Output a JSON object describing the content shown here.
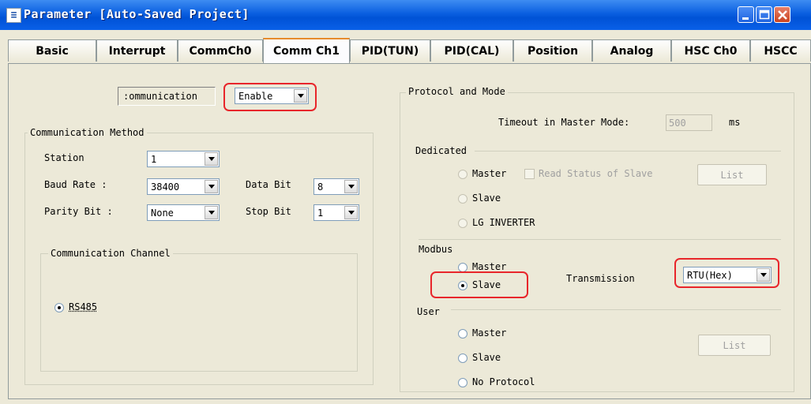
{
  "window": {
    "title": "Parameter [Auto-Saved Project]",
    "title_icon": "hanzi-icon"
  },
  "tabs": [
    "Basic",
    "Interrupt",
    "CommCh0",
    "Comm Ch1",
    "PID(TUN)",
    "PID(CAL)",
    "Position",
    "Analog",
    "HSC Ch0",
    "HSCC"
  ],
  "active_tab": "Comm Ch1",
  "communication": {
    "label": ":ommunication",
    "value": "Enable"
  },
  "method": {
    "title": "Communication Method",
    "station_label": "Station",
    "station_value": "1",
    "baud_label": "Baud Rate :",
    "baud_value": "38400",
    "databit_label": "Data Bit",
    "databit_value": "8",
    "parity_label": "Parity Bit :",
    "parity_value": "None",
    "stopbit_label": "Stop Bit",
    "stopbit_value": "1"
  },
  "channel": {
    "title": "Communication Channel",
    "option": "RS485"
  },
  "protocol": {
    "title": "Protocol and Mode",
    "timeout_label": "Timeout in Master Mode:",
    "timeout_value": "500",
    "timeout_unit": "ms",
    "dedicated": {
      "title": "Dedicated",
      "master": "Master",
      "read_status": "Read Status of Slave",
      "list": "List",
      "slave": "Slave",
      "lg_inverter": "LG INVERTER"
    },
    "modbus": {
      "title": "Modbus",
      "master": "Master",
      "slave": "Slave",
      "transmission_label": "Transmission",
      "transmission_value": "RTU(Hex)"
    },
    "user": {
      "title": "User",
      "master": "Master",
      "slave": "Slave",
      "list": "List",
      "no_protocol": "No Protocol"
    }
  },
  "colors": {
    "highlight": "#e8262b",
    "titlebar": "#0a5fe0",
    "face": "#ece9d8",
    "active_tab_accent": "#e68b2c"
  }
}
